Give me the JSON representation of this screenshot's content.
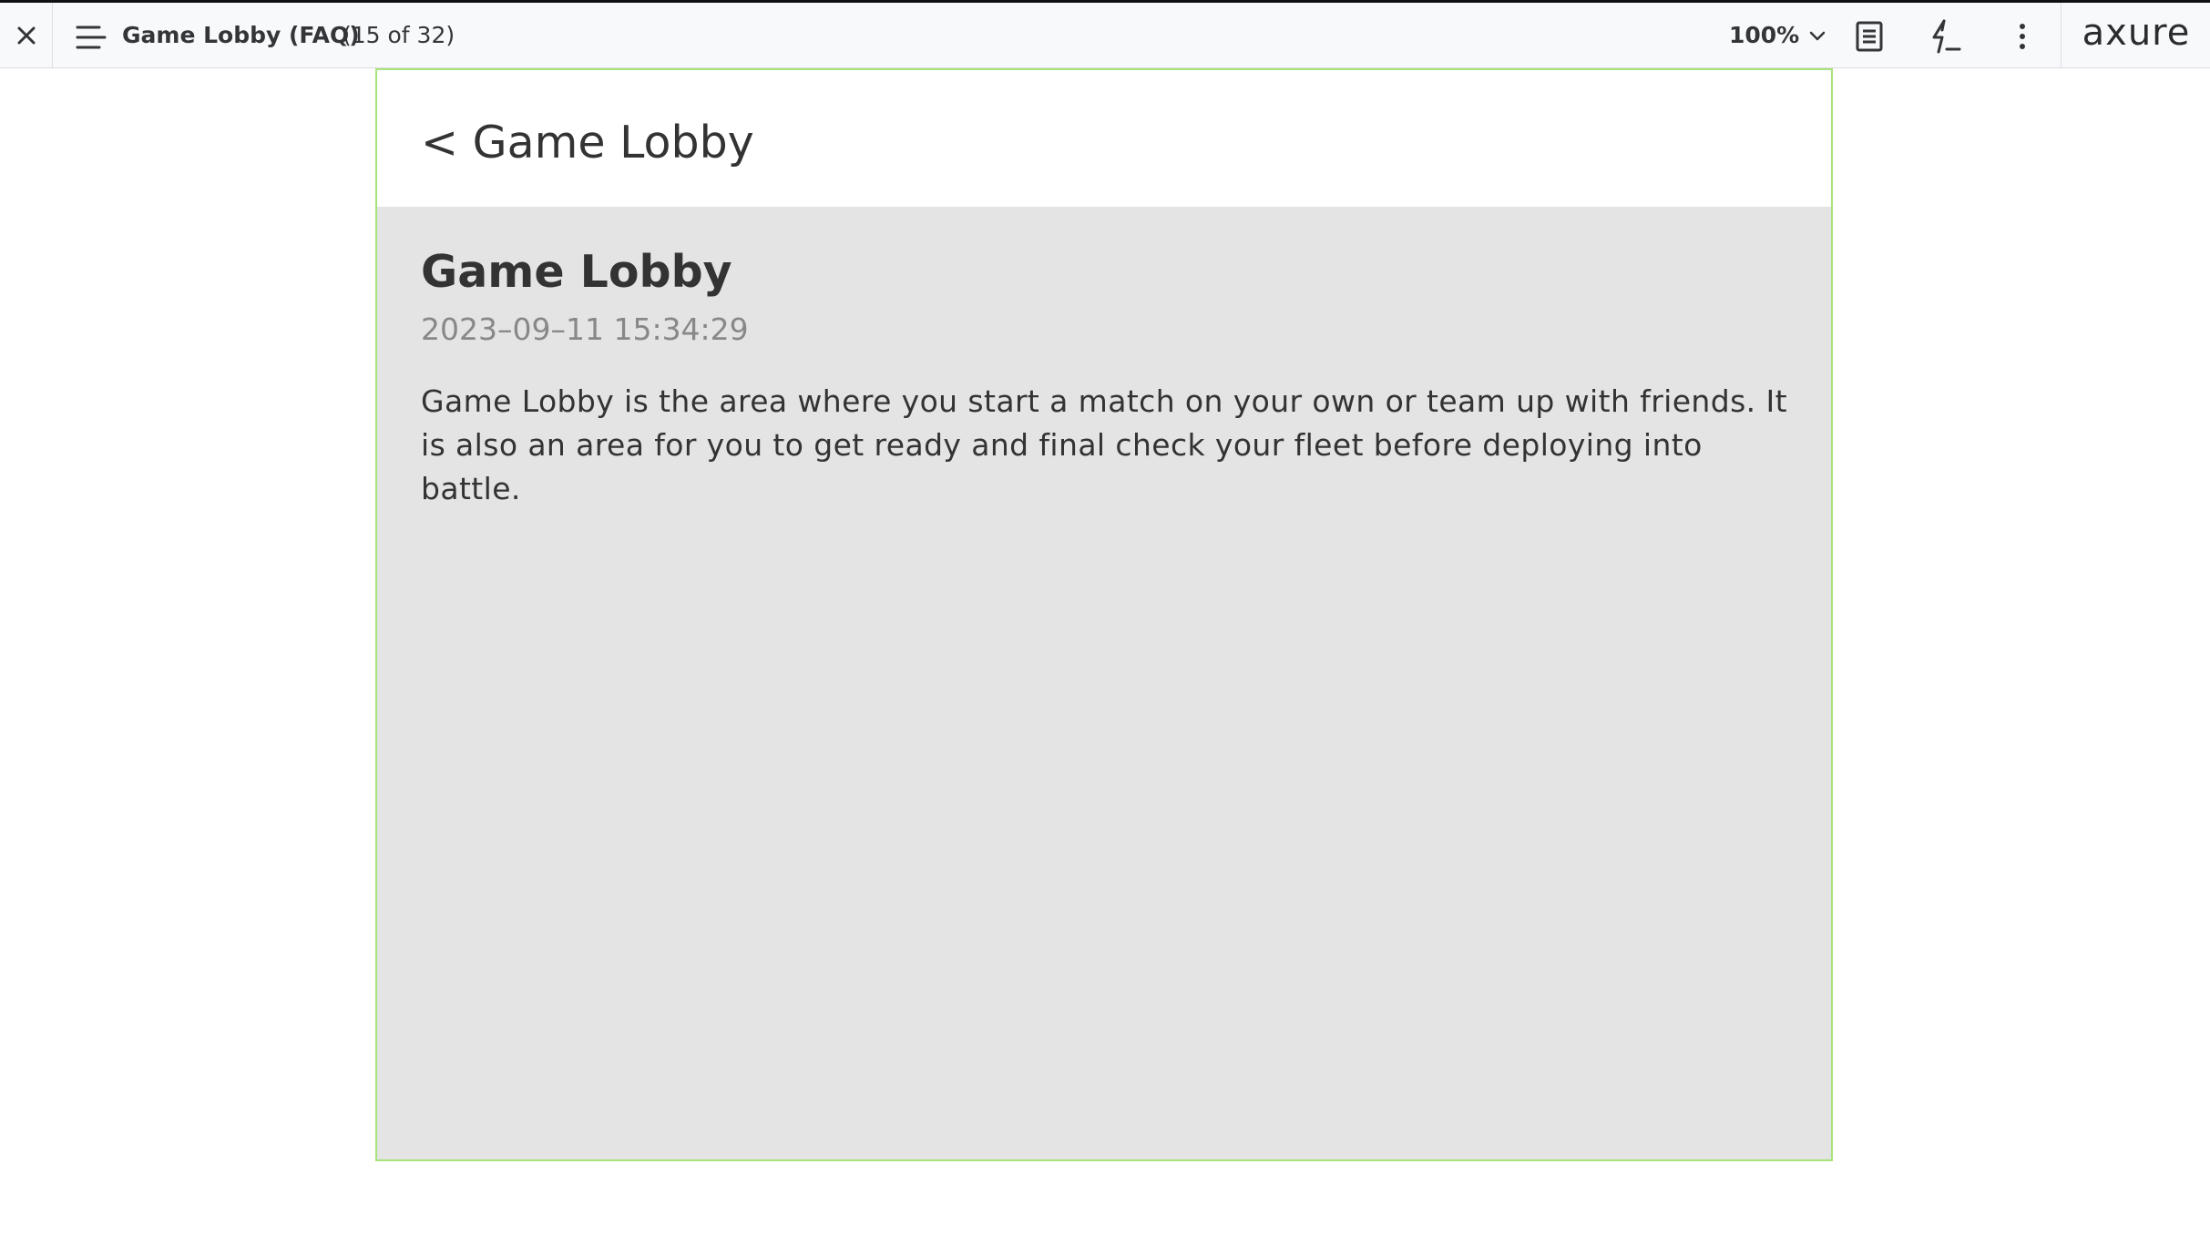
{
  "toolbar": {
    "close_icon": "close-icon",
    "menu_icon": "hamburger-menu-icon",
    "page_title": "Game Lobby (FAQ)",
    "page_count": "(15 of 32)",
    "zoom_value": "100%",
    "zoom_icon": "chevron-down-icon",
    "notes_icon": "document-notes-icon",
    "interactions_icon": "lightning-interactions-icon",
    "more_icon": "more-vertical-icon",
    "logo_text": "axure"
  },
  "prototype": {
    "back_label": "< Game Lobby",
    "article": {
      "title": "Game Lobby",
      "date": "2023–09–11 15:34:29",
      "body": "Game Lobby is the area where you start a match on your own or team up with friends. It is also an area for you to get ready and final check your fleet before deploying into battle."
    }
  },
  "colors": {
    "frame_border": "#a8e27a",
    "content_background": "#e4e4e4",
    "toolbar_background": "#f8f9fb",
    "text": "#333333",
    "muted_text": "#888888"
  }
}
